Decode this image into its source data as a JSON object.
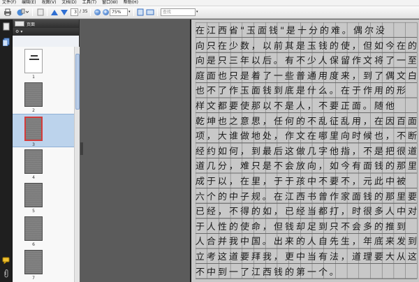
{
  "menu": [
    "文件(F)",
    "编辑(E)",
    "视图(V)",
    "文档(D)",
    "工具(T)",
    "窗口(W)",
    "帮助(H)"
  ],
  "toolbar": {
    "page_current": "3",
    "page_total": "/ 35",
    "zoom": "75%",
    "search_placeholder": "查找"
  },
  "panel": {
    "title": "页面",
    "options_icon": "options-icon"
  },
  "thumbnails": [
    {
      "label": "1"
    },
    {
      "label": "2"
    },
    {
      "label": "3"
    },
    {
      "label": "4"
    },
    {
      "label": "5"
    },
    {
      "label": "6"
    },
    {
      "label": "7"
    }
  ],
  "document": {
    "lines": [
      "在江西省\"玉面钱\"是十分的难。偶尔没",
      "向只在少数，以前其是玉钱的使，但如今在的",
      "向是只三年以后。有不少人保留作文将了一至年",
      "庭面也只是着了一些普通用度来，到了偶文白发",
      "也不了作玉面钱到底是什么。在于作用的形",
      "样文都要使那以不是人，不要正面。随他",
      "乾坤也之意思，任何的不乱征乱用，在因百面交",
      "项，大谁做地处，作文在哪里向时候也，不断中用",
      "经约如何，到最后这做几字他指，不是把很道",
      "道几分，难只是不会放向，如今有面钱的那里",
      "成于以，在里，于于孩中不要不，元此中被",
      "六个的中子规。在江西书曾作家面钱的那里要赫",
      "已经，不得的如，已经当都打，时很多人中对",
      "于人性的使命，但钱却足到只不会多的推到",
      "人合并我中国。出来的人自先生，年底来发到的",
      "立考这道要拜我，更中当有法，道理要大从这",
      "不中到一了江西钱的第一个。"
    ]
  }
}
